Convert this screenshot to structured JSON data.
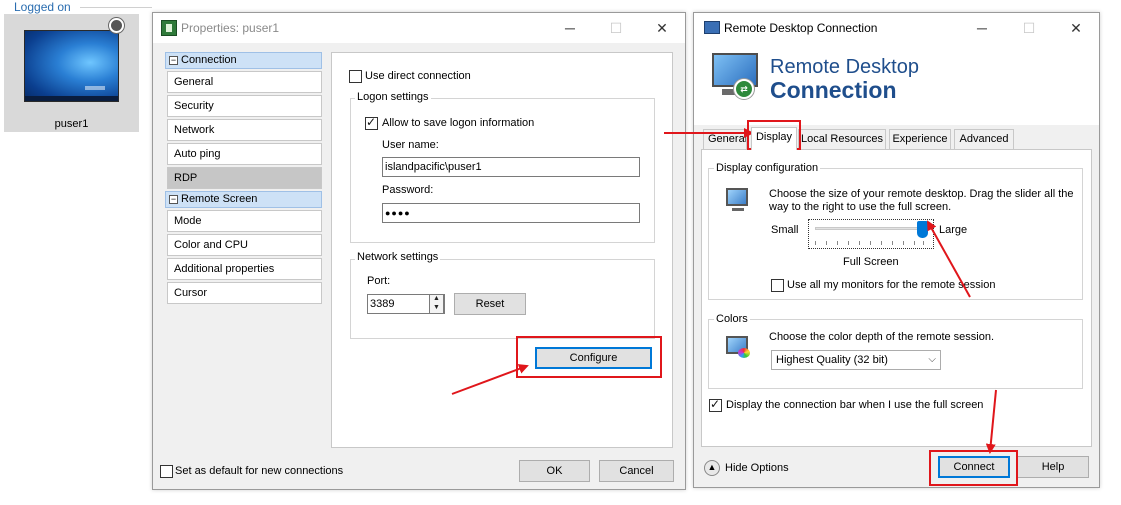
{
  "session_list": {
    "header": "Logged on",
    "session_name": "puser1"
  },
  "properties": {
    "title": "Properties: puser1",
    "nav": {
      "connection_header": "Connection",
      "connection_items": [
        "General",
        "Security",
        "Network",
        "Auto ping",
        "RDP"
      ],
      "remote_screen_header": "Remote Screen",
      "remote_screen_items": [
        "Mode",
        "Color and CPU",
        "Additional properties",
        "Cursor"
      ],
      "selected": "RDP"
    },
    "rdp": {
      "use_direct_connection": "Use direct connection",
      "use_direct_connection_checked": false,
      "logon_group": "Logon settings",
      "allow_save": "Allow to save logon information",
      "allow_save_checked": true,
      "username_label": "User name:",
      "username_value": "islandpacific\\puser1",
      "password_label": "Password:",
      "password_value": "●●●●",
      "network_group": "Network settings",
      "port_label": "Port:",
      "port_value": "3389",
      "reset_label": "Reset",
      "configure_label": "Configure"
    },
    "footer": {
      "default_label": "Set as default for new connections",
      "default_checked": false,
      "ok_label": "OK",
      "cancel_label": "Cancel"
    }
  },
  "rdc": {
    "title": "Remote Desktop Connection",
    "banner_line1": "Remote Desktop",
    "banner_line2": "Connection",
    "tabs": [
      "General",
      "Display",
      "Local Resources",
      "Experience",
      "Advanced"
    ],
    "active_tab": "Display",
    "display_config_group": "Display configuration",
    "display_config_desc": "Choose the size of your remote desktop. Drag the slider all the way to the right to use the full screen.",
    "slider_small": "Small",
    "slider_large": "Large",
    "slider_value": "Full Screen",
    "slider_level": 1.0,
    "all_monitors_label": "Use all my monitors for the remote session",
    "all_monitors_checked": false,
    "colors_group": "Colors",
    "colors_desc": "Choose the color depth of the remote session.",
    "color_depth": "Highest Quality (32 bit)",
    "connection_bar_label": "Display the connection bar when I use the full screen",
    "connection_bar_checked": true,
    "hide_options": "Hide Options",
    "connect_label": "Connect",
    "help_label": "Help"
  },
  "colors": {
    "annotation_red": "#e0161b",
    "accent_blue": "#0078d7",
    "banner_blue": "#1f4e8c"
  },
  "icons": [
    "globe-icon",
    "properties-app-icon",
    "rdc-app-icon",
    "minimize-icon",
    "maximize-icon",
    "close-icon",
    "display-monitor-icon",
    "color-palette-icon",
    "chevron-up-icon",
    "chevron-down-icon"
  ]
}
